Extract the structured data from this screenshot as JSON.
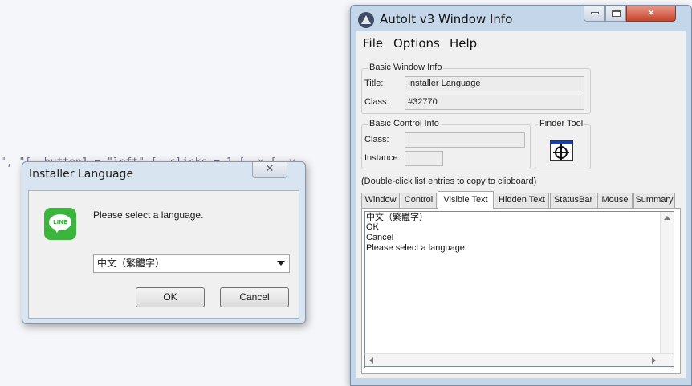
{
  "background": {
    "code_text": "\", \"[  button1 = \"left\" [  clicks = 1 [  x [, y"
  },
  "installer_dialog": {
    "title": "Installer Language",
    "close_glyph": "✕",
    "logo_text": "LINE",
    "prompt": "Please select a language.",
    "language_select": {
      "value": "中文（繁體字）"
    },
    "ok_label": "OK",
    "cancel_label": "Cancel",
    "logo_color": "#3bb53b"
  },
  "autoit_window": {
    "title": "AutoIt v3 Window Info",
    "menu": [
      "File",
      "Options",
      "Help"
    ],
    "basic_window_info": {
      "group_label": "Basic Window Info",
      "title_label": "Title:",
      "title_value": "Installer Language",
      "class_label": "Class:",
      "class_value": "#32770"
    },
    "basic_control_info": {
      "group_label": "Basic Control Info",
      "class_label": "Class:",
      "class_value": "",
      "instance_label": "Instance:",
      "instance_value": ""
    },
    "finder_tool": {
      "group_label": "Finder Tool"
    },
    "hint": "(Double-click list entries to copy to clipboard)",
    "tabs": [
      "Window",
      "Control",
      "Visible Text",
      "Hidden Text",
      "StatusBar",
      "Mouse",
      "Summary"
    ],
    "active_tab": "Visible Text",
    "visible_text_lines": [
      "中文（繁體字）",
      "OK",
      "Cancel",
      "Please select a language."
    ]
  }
}
